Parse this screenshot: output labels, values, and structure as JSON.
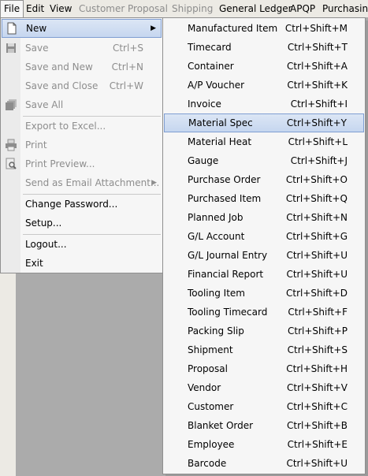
{
  "menubar": {
    "file": "File",
    "edit": "Edit",
    "view": "View",
    "customer": "Customer",
    "proposal": "Proposal",
    "shipping": "Shipping",
    "general_ledger": "General Ledger",
    "apqp": "APQP",
    "purchasing": "Purchasing"
  },
  "file_menu": {
    "new": "New",
    "save": "Save",
    "save_sc": "Ctrl+S",
    "save_new": "Save and New",
    "save_new_sc": "Ctrl+N",
    "save_close": "Save and Close",
    "save_close_sc": "Ctrl+W",
    "save_all": "Save All",
    "export": "Export to Excel...",
    "print": "Print",
    "print_preview": "Print Preview...",
    "email": "Send as Email Attachment...",
    "change_password": "Change Password...",
    "setup": "Setup...",
    "logout": "Logout...",
    "exit": "Exit"
  },
  "new_submenu": [
    {
      "label": "Manufactured Item",
      "shortcut": "Ctrl+Shift+M"
    },
    {
      "label": "Timecard",
      "shortcut": "Ctrl+Shift+T"
    },
    {
      "label": "Container",
      "shortcut": "Ctrl+Shift+A"
    },
    {
      "label": "A/P Voucher",
      "shortcut": "Ctrl+Shift+K"
    },
    {
      "label": "Invoice",
      "shortcut": "Ctrl+Shift+I"
    },
    {
      "label": "Material Spec",
      "shortcut": "Ctrl+Shift+Y"
    },
    {
      "label": "Material Heat",
      "shortcut": "Ctrl+Shift+L"
    },
    {
      "label": "Gauge",
      "shortcut": "Ctrl+Shift+J"
    },
    {
      "label": "Purchase Order",
      "shortcut": "Ctrl+Shift+O"
    },
    {
      "label": "Purchased Item",
      "shortcut": "Ctrl+Shift+Q"
    },
    {
      "label": "Planned Job",
      "shortcut": "Ctrl+Shift+N"
    },
    {
      "label": "G/L Account",
      "shortcut": "Ctrl+Shift+G"
    },
    {
      "label": "G/L Journal Entry",
      "shortcut": "Ctrl+Shift+U"
    },
    {
      "label": "Financial Report",
      "shortcut": "Ctrl+Shift+U"
    },
    {
      "label": "Tooling Item",
      "shortcut": "Ctrl+Shift+D"
    },
    {
      "label": "Tooling Timecard",
      "shortcut": "Ctrl+Shift+F"
    },
    {
      "label": "Packing Slip",
      "shortcut": "Ctrl+Shift+P"
    },
    {
      "label": "Shipment",
      "shortcut": "Ctrl+Shift+S"
    },
    {
      "label": "Proposal",
      "shortcut": "Ctrl+Shift+H"
    },
    {
      "label": "Vendor",
      "shortcut": "Ctrl+Shift+V"
    },
    {
      "label": "Customer",
      "shortcut": "Ctrl+Shift+C"
    },
    {
      "label": "Blanket Order",
      "shortcut": "Ctrl+Shift+B"
    },
    {
      "label": "Employee",
      "shortcut": "Ctrl+Shift+E"
    },
    {
      "label": "Barcode",
      "shortcut": "Ctrl+Shift+U"
    }
  ],
  "highlighted_submenu_item": "Material Spec",
  "colors": {
    "highlight_border": "#7f9ed2",
    "highlight_fill": "#c6d6ef",
    "disabled_text": "#8d8d8d",
    "menu_bg": "#f6f6f6",
    "workspace_bg": "#ababab"
  }
}
